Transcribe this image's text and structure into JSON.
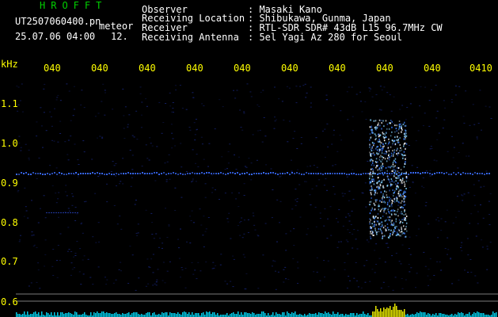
{
  "header": {
    "brand": "HROFFT",
    "file_name": "UT2507060400.pn",
    "timestamp": "25.07.06 04:00",
    "count_value": "12.",
    "meteor_label": "meteor",
    "info": [
      {
        "label": "Observer",
        "value": ": Masaki Kano"
      },
      {
        "label": "Receiving Location",
        "value": ": Shibukawa, Gunma, Japan"
      },
      {
        "label": "Receiver",
        "value": ": RTL-SDR SDR# 43dB L15 96.7MHz CW"
      },
      {
        "label": "Receiving Antenna",
        "value": ": 5el Yagi Az 280 for Seoul"
      }
    ]
  },
  "axes": {
    "y_unit": "kHz",
    "y_ticks": [
      "1.1",
      "1.0",
      "0.9",
      "0.8",
      "0.7",
      "0.6"
    ],
    "x_ticks": [
      "040",
      "040",
      "040",
      "040",
      "040",
      "040",
      "040",
      "040",
      "040",
      "0410"
    ]
  },
  "colors": {
    "text_white": "#ffffff",
    "text_yellow": "#ffff00",
    "brand_green": "#00d000",
    "carrier": "#3a6cff",
    "meteor_echo": "#7fd0ff",
    "signal_trace": "#00e0ff",
    "signal_peak": "#ffff00"
  }
}
